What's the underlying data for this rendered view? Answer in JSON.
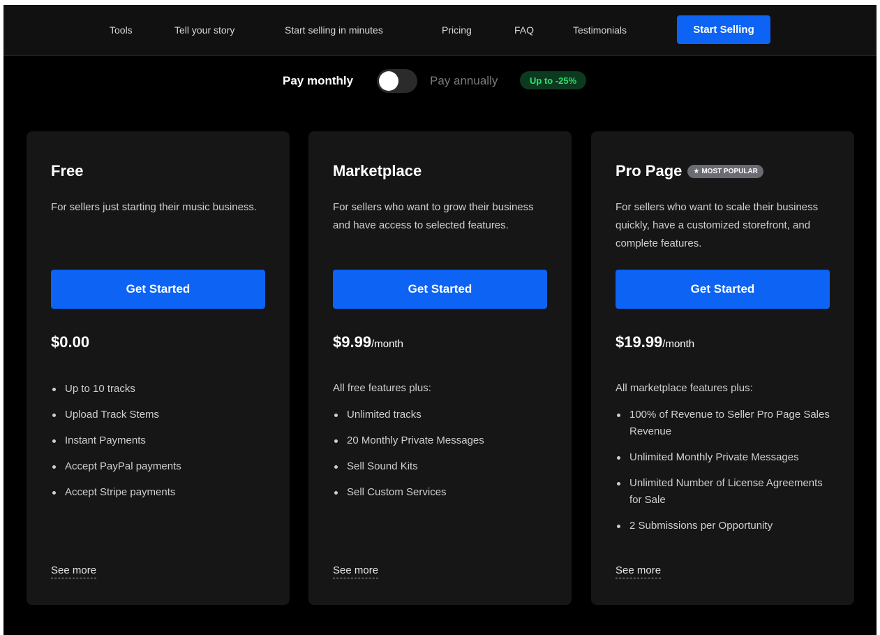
{
  "nav": {
    "links": [
      "Tools",
      "Tell your story",
      "Start selling in minutes",
      "Pricing",
      "FAQ",
      "Testimonials"
    ],
    "cta_label": "Start Selling"
  },
  "billing": {
    "monthly_label": "Pay monthly",
    "annual_label": "Pay annually",
    "discount_badge": "Up to -25%",
    "selected": "monthly"
  },
  "plans": [
    {
      "title": "Free",
      "badge": "",
      "description": "For sellers just starting their music business.",
      "cta_label": "Get Started",
      "price": "$0.00",
      "period": "",
      "features_intro": "",
      "features": [
        "Up to 10 tracks",
        "Upload Track Stems",
        "Instant Payments",
        "Accept PayPal payments",
        "Accept Stripe payments"
      ],
      "see_more": "See more"
    },
    {
      "title": "Marketplace",
      "badge": "",
      "description": "For sellers who want to grow their business and have access to selected features.",
      "cta_label": "Get Started",
      "price": "$9.99",
      "period": "/month",
      "features_intro": "All free features plus:",
      "features": [
        "Unlimited tracks",
        "20 Monthly Private Messages",
        "Sell Sound Kits",
        "Sell Custom Services"
      ],
      "see_more": "See more"
    },
    {
      "title": "Pro Page",
      "badge": "MOST POPULAR",
      "badge_icon": "star-icon",
      "description": "For sellers who want to scale their business quickly, have a customized storefront, and complete features.",
      "cta_label": "Get Started",
      "price": "$19.99",
      "period": "/month",
      "features_intro": "All marketplace features plus:",
      "features": [
        "100% of Revenue to Seller Pro Page Sales Revenue",
        "Unlimited Monthly Private Messages",
        "Unlimited Number of License Agreements for Sale",
        "2 Submissions per Opportunity"
      ],
      "see_more": "See more"
    }
  ],
  "colors": {
    "accent": "#0c63f4",
    "background": "#000000",
    "card": "#161616",
    "discount_text": "#2ee06e"
  }
}
